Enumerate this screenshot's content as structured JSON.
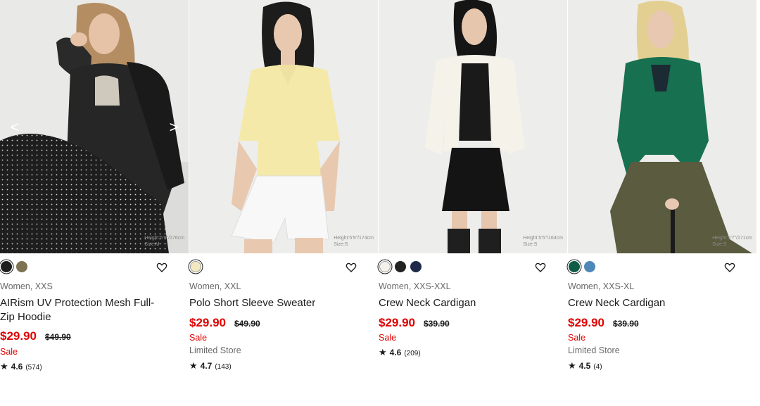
{
  "products": [
    {
      "height_tag": [
        "Height:5'9\"/176cm",
        "Size:M"
      ],
      "colors": [
        "#1f1f1f",
        "#7d7252"
      ],
      "selected_color": 0,
      "meta": "Women, XXS",
      "name": "AIRism UV Protection Mesh Full-Zip Hoodie",
      "price": "$29.90",
      "original_price": "$49.90",
      "sale_label": "Sale",
      "store_label": "",
      "rating": "4.6",
      "reviews": "(574)",
      "has_carousel_arrows": true
    },
    {
      "height_tag": [
        "Height:5'9\"/174cm",
        "Size:S"
      ],
      "colors": [
        "#f3e9c0"
      ],
      "selected_color": 0,
      "meta": "Women, XXL",
      "name": "Polo Short Sleeve Sweater",
      "price": "$29.90",
      "original_price": "$49.90",
      "sale_label": "Sale",
      "store_label": "Limited Store",
      "rating": "4.7",
      "reviews": "(143)",
      "has_carousel_arrows": false
    },
    {
      "height_tag": [
        "Height:5'5\"/164cm",
        "Size:S"
      ],
      "colors": [
        "#f4f1ea",
        "#222222",
        "#1f2a4a"
      ],
      "selected_color": 0,
      "meta": "Women, XXS-XXL",
      "name": "Crew Neck Cardigan",
      "price": "$29.90",
      "original_price": "$39.90",
      "sale_label": "Sale",
      "store_label": "",
      "rating": "4.6",
      "reviews": "(209)",
      "has_carousel_arrows": false
    },
    {
      "height_tag": [
        "Height:5'7\"/171cm",
        "Size:S"
      ],
      "colors": [
        "#0f5c45",
        "#4f87b8"
      ],
      "selected_color": 0,
      "meta": "Women, XXS-XL",
      "name": "Crew Neck Cardigan",
      "price": "$29.90",
      "original_price": "$39.90",
      "sale_label": "Sale",
      "store_label": "Limited Store",
      "rating": "4.5",
      "reviews": "(4)",
      "has_carousel_arrows": false
    }
  ],
  "icons": {
    "arrow_left": "<",
    "arrow_right": ">",
    "favorite": "heart-outline-icon",
    "star": "★"
  },
  "colors": {
    "sale_red": "#e00000",
    "text": "#1b1b1b",
    "muted": "#6a6a6a"
  }
}
